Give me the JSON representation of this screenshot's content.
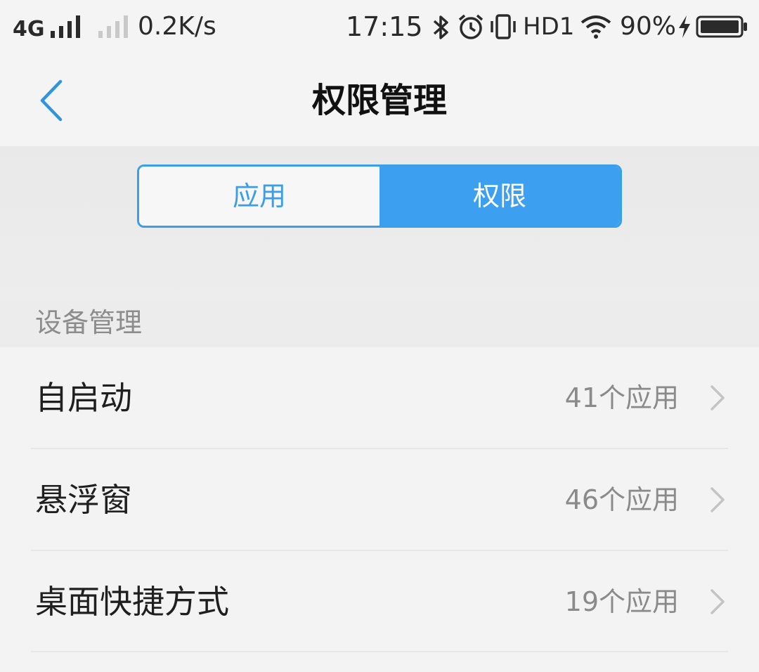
{
  "status_bar": {
    "network": "4G",
    "speed": "0.2K/s",
    "time": "17:15",
    "hd_label": "HD1",
    "battery_percent": "90%",
    "icons": [
      "signal-icon",
      "signal-weak-icon",
      "bluetooth-icon",
      "alarm-icon",
      "vibrate-icon",
      "wifi-icon",
      "charging-icon",
      "battery-icon"
    ]
  },
  "nav": {
    "back_icon": "back-chevron-icon",
    "title": "权限管理"
  },
  "segments": {
    "tabs": [
      {
        "label": "应用",
        "active": false
      },
      {
        "label": "权限",
        "active": true
      }
    ],
    "accent_color": "#3d9ff0"
  },
  "section": {
    "title": "设备管理"
  },
  "list": {
    "items": [
      {
        "label": "自启动",
        "count": "41个应用"
      },
      {
        "label": "悬浮窗",
        "count": "46个应用"
      },
      {
        "label": "桌面快捷方式",
        "count": "19个应用"
      }
    ],
    "chevron_icon": "chevron-right-icon"
  }
}
